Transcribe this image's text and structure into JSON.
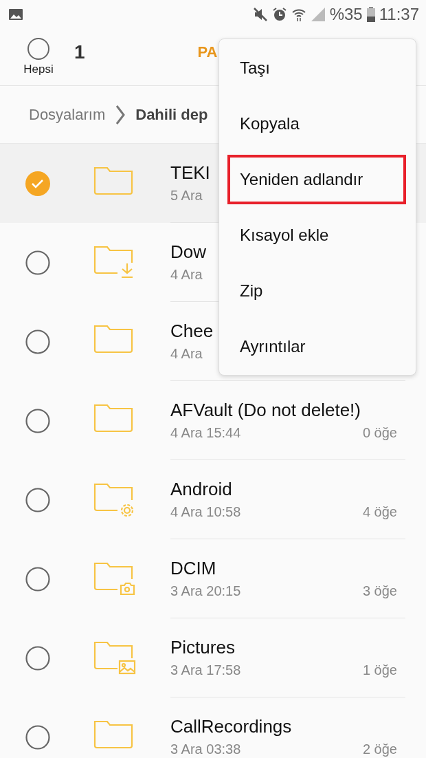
{
  "status_bar": {
    "battery_text": "%35",
    "time": "11:37"
  },
  "toolbar": {
    "select_all": {
      "label": "Hepsi",
      "selected": false
    },
    "count": "1",
    "action": "PA"
  },
  "breadcrumb": [
    "Dosyalarım",
    "Dahili dep"
  ],
  "files": [
    {
      "name": "TEKI",
      "date": "5 Ara",
      "selected": true,
      "kind": "plain"
    },
    {
      "name": "Dow",
      "date": "4 Ara",
      "selected": false,
      "kind": "download"
    },
    {
      "name": "Chee",
      "date": "4 Ara",
      "selected": false,
      "kind": "plain"
    },
    {
      "name": "AFVault (Do not delete!)",
      "date": "4 Ara 15:44",
      "count": "0 öğe",
      "selected": false,
      "kind": "plain"
    },
    {
      "name": "Android",
      "date": "4 Ara 10:58",
      "count": "4 öğe",
      "selected": false,
      "kind": "settings"
    },
    {
      "name": "DCIM",
      "date": "3 Ara 20:15",
      "count": "3 öğe",
      "selected": false,
      "kind": "camera"
    },
    {
      "name": "Pictures",
      "date": "3 Ara 17:58",
      "count": "1 öğe",
      "selected": false,
      "kind": "image"
    },
    {
      "name": "CallRecordings",
      "date": "3 Ara 03:38",
      "count": "2 öğe",
      "selected": false,
      "kind": "plain"
    }
  ],
  "menu": [
    {
      "label": "Taşı",
      "highlighted": false
    },
    {
      "label": "Kopyala",
      "highlighted": false
    },
    {
      "label": "Yeniden adlandır",
      "highlighted": true
    },
    {
      "label": "Kısayol ekle",
      "highlighted": false
    },
    {
      "label": "Zip",
      "highlighted": false
    },
    {
      "label": "Ayrıntılar",
      "highlighted": false
    }
  ]
}
